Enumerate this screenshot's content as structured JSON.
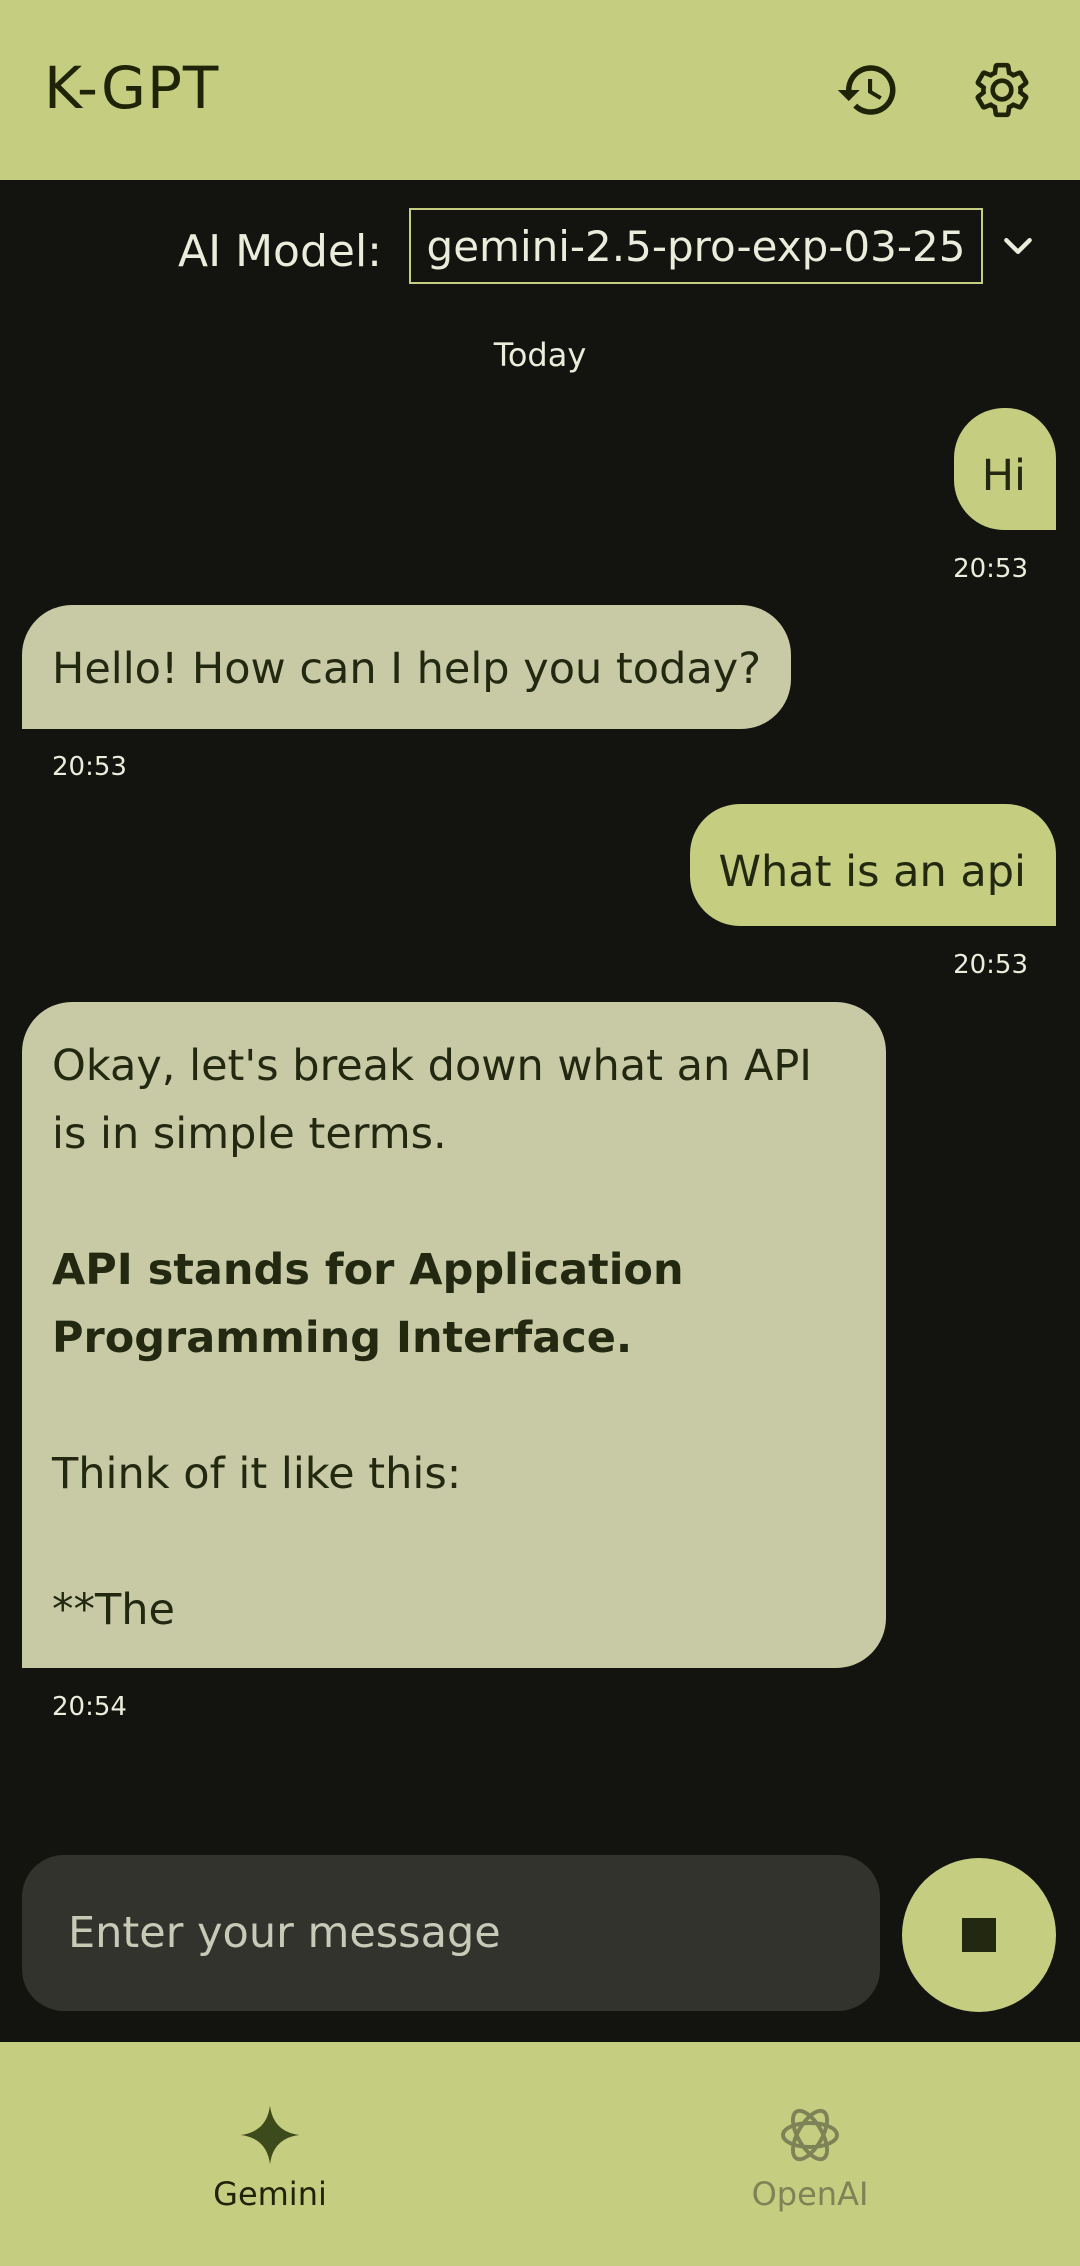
{
  "app": {
    "title": "K-GPT"
  },
  "toolbar": {
    "history_icon": "history-icon",
    "settings_icon": "gear-icon"
  },
  "model_selector": {
    "label": "AI Model:",
    "selected": "gemini-2.5-pro-exp-03-25",
    "dropdown_icon": "chevron-down-icon"
  },
  "chat": {
    "date_divider": "Today",
    "messages": [
      {
        "role": "user",
        "text": "Hi",
        "time": "20:53"
      },
      {
        "role": "assistant",
        "text": "Hello! How can I help you today?",
        "time": "20:53"
      },
      {
        "role": "user",
        "text": "What is an api",
        "time": "20:53"
      },
      {
        "role": "assistant",
        "time": "20:54",
        "paragraphs": [
          {
            "text": "Okay, let's break down what an API is in simple terms.",
            "bold": false
          },
          {
            "text": "API stands for Application Programming Interface.",
            "bold": true
          },
          {
            "text": "Think of it like this:",
            "bold": false
          },
          {
            "text": "**The",
            "bold": false
          }
        ]
      }
    ]
  },
  "composer": {
    "placeholder": "Enter your message",
    "stop_icon": "stop-icon"
  },
  "bottom_nav": {
    "items": [
      {
        "label": "Gemini",
        "icon": "gemini-sparkle-icon",
        "active": true
      },
      {
        "label": "OpenAI",
        "icon": "openai-logo-icon",
        "active": false
      }
    ]
  },
  "colors": {
    "accent": "#c4cd80",
    "background": "#131410",
    "assistant_bubble": "#c8caa6",
    "on_accent": "#1f2406"
  }
}
